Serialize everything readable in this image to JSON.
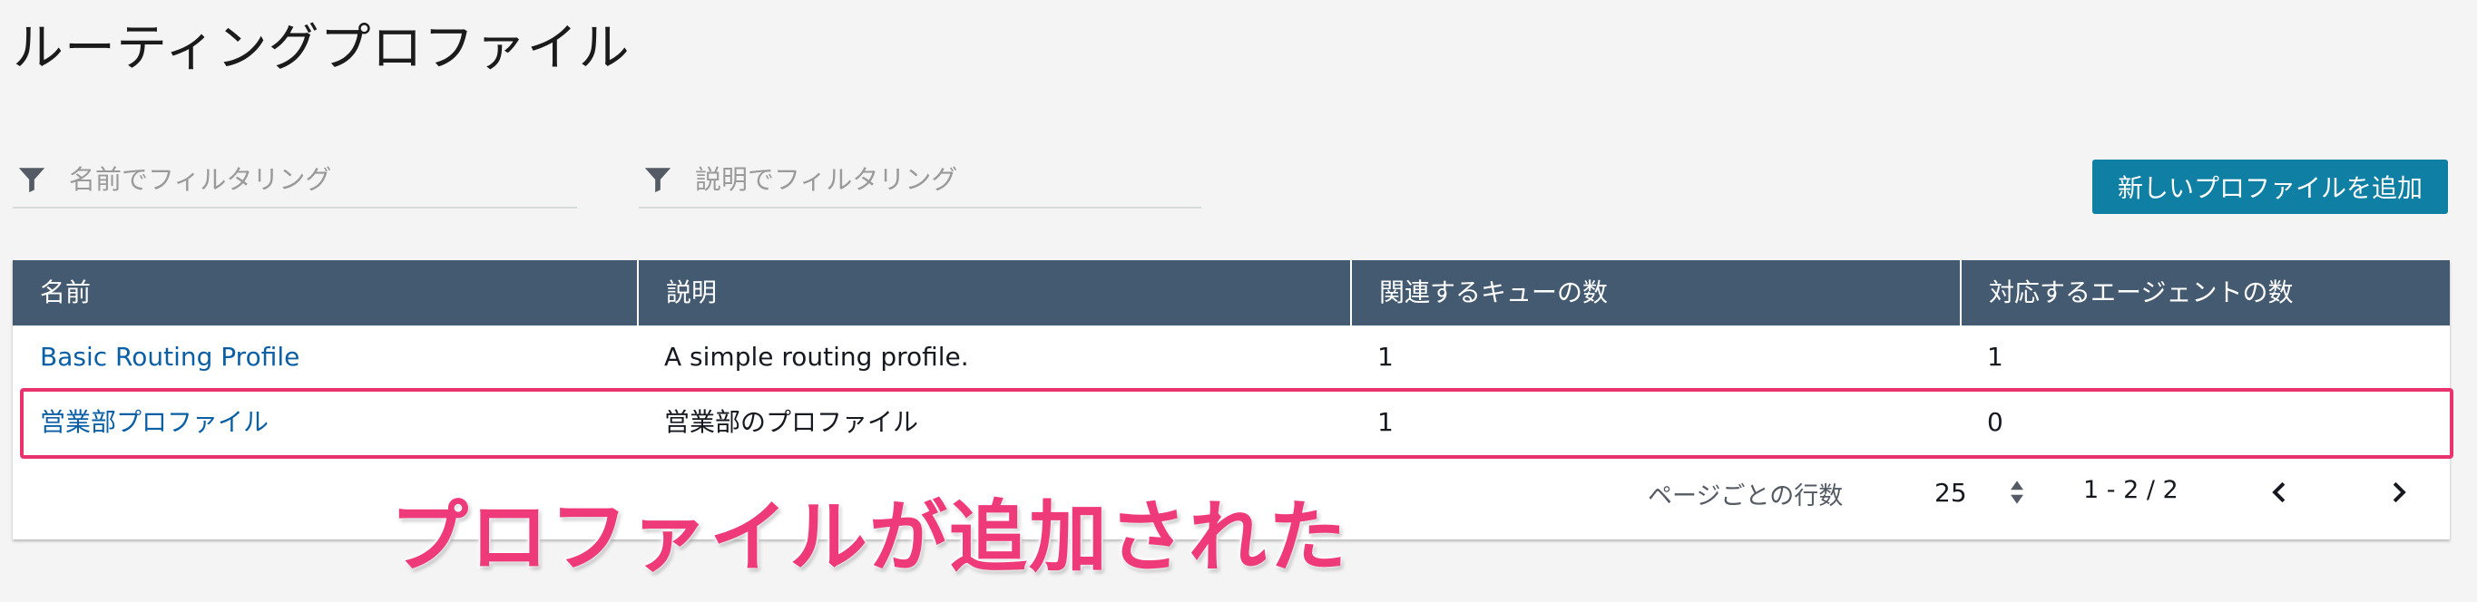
{
  "page": {
    "title": "ルーティングプロファイル"
  },
  "filters": {
    "name_placeholder": "名前でフィルタリング",
    "description_placeholder": "説明でフィルタリング",
    "icon": "filter-icon"
  },
  "toolbar": {
    "add_label": "新しいプロファイルを追加"
  },
  "table": {
    "headers": [
      "名前",
      "説明",
      "関連するキューの数",
      "対応するエージェントの数"
    ],
    "rows": [
      {
        "name": "Basic Routing Profile",
        "description": "A simple routing profile.",
        "queues": "1",
        "agents": "1"
      },
      {
        "name": "営業部プロファイル",
        "description": "営業部のプロファイル",
        "queues": "1",
        "agents": "0"
      }
    ]
  },
  "pagination": {
    "rows_per_page_label": "ページごとの行数",
    "rows_per_page_value": "25",
    "range": "1 - 2 / 2"
  },
  "annotation": {
    "text": "プロファイルが追加された"
  },
  "colors": {
    "header_bg": "#445a70",
    "button_bg": "#0f7fa3",
    "link": "#0b5fa5",
    "highlight": "#e8336f"
  }
}
